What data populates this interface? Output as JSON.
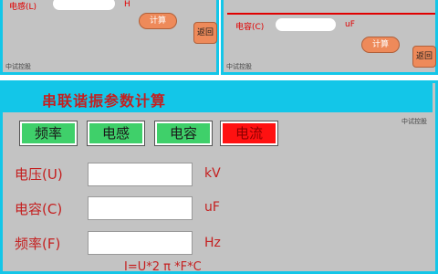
{
  "top_left": {
    "inductance_label": "电感(L)",
    "inductance_unit": "H",
    "calc_label": "计算",
    "back_label": "返回",
    "footer": "中试控股"
  },
  "top_right": {
    "capacitance_label": "电容(C)",
    "capacitance_unit": "uF",
    "calc_label": "计算",
    "back_label": "返回",
    "footer": "中试控股"
  },
  "main": {
    "title": "串联谐振参数计算",
    "watermark": "中试控股",
    "tabs": [
      {
        "label": "频率",
        "color": "#3fd06a"
      },
      {
        "label": "电感",
        "color": "#3fd06a"
      },
      {
        "label": "电容",
        "color": "#3fd06a"
      },
      {
        "label": "电流",
        "color": "#ff1111"
      }
    ],
    "rows": [
      {
        "label": "电压(U)",
        "unit": "kV",
        "value": ""
      },
      {
        "label": "电容(C)",
        "unit": "uF",
        "value": ""
      },
      {
        "label": "频率(F)",
        "unit": "Hz",
        "value": ""
      }
    ],
    "formula": "I=U*2 π *F*C"
  }
}
